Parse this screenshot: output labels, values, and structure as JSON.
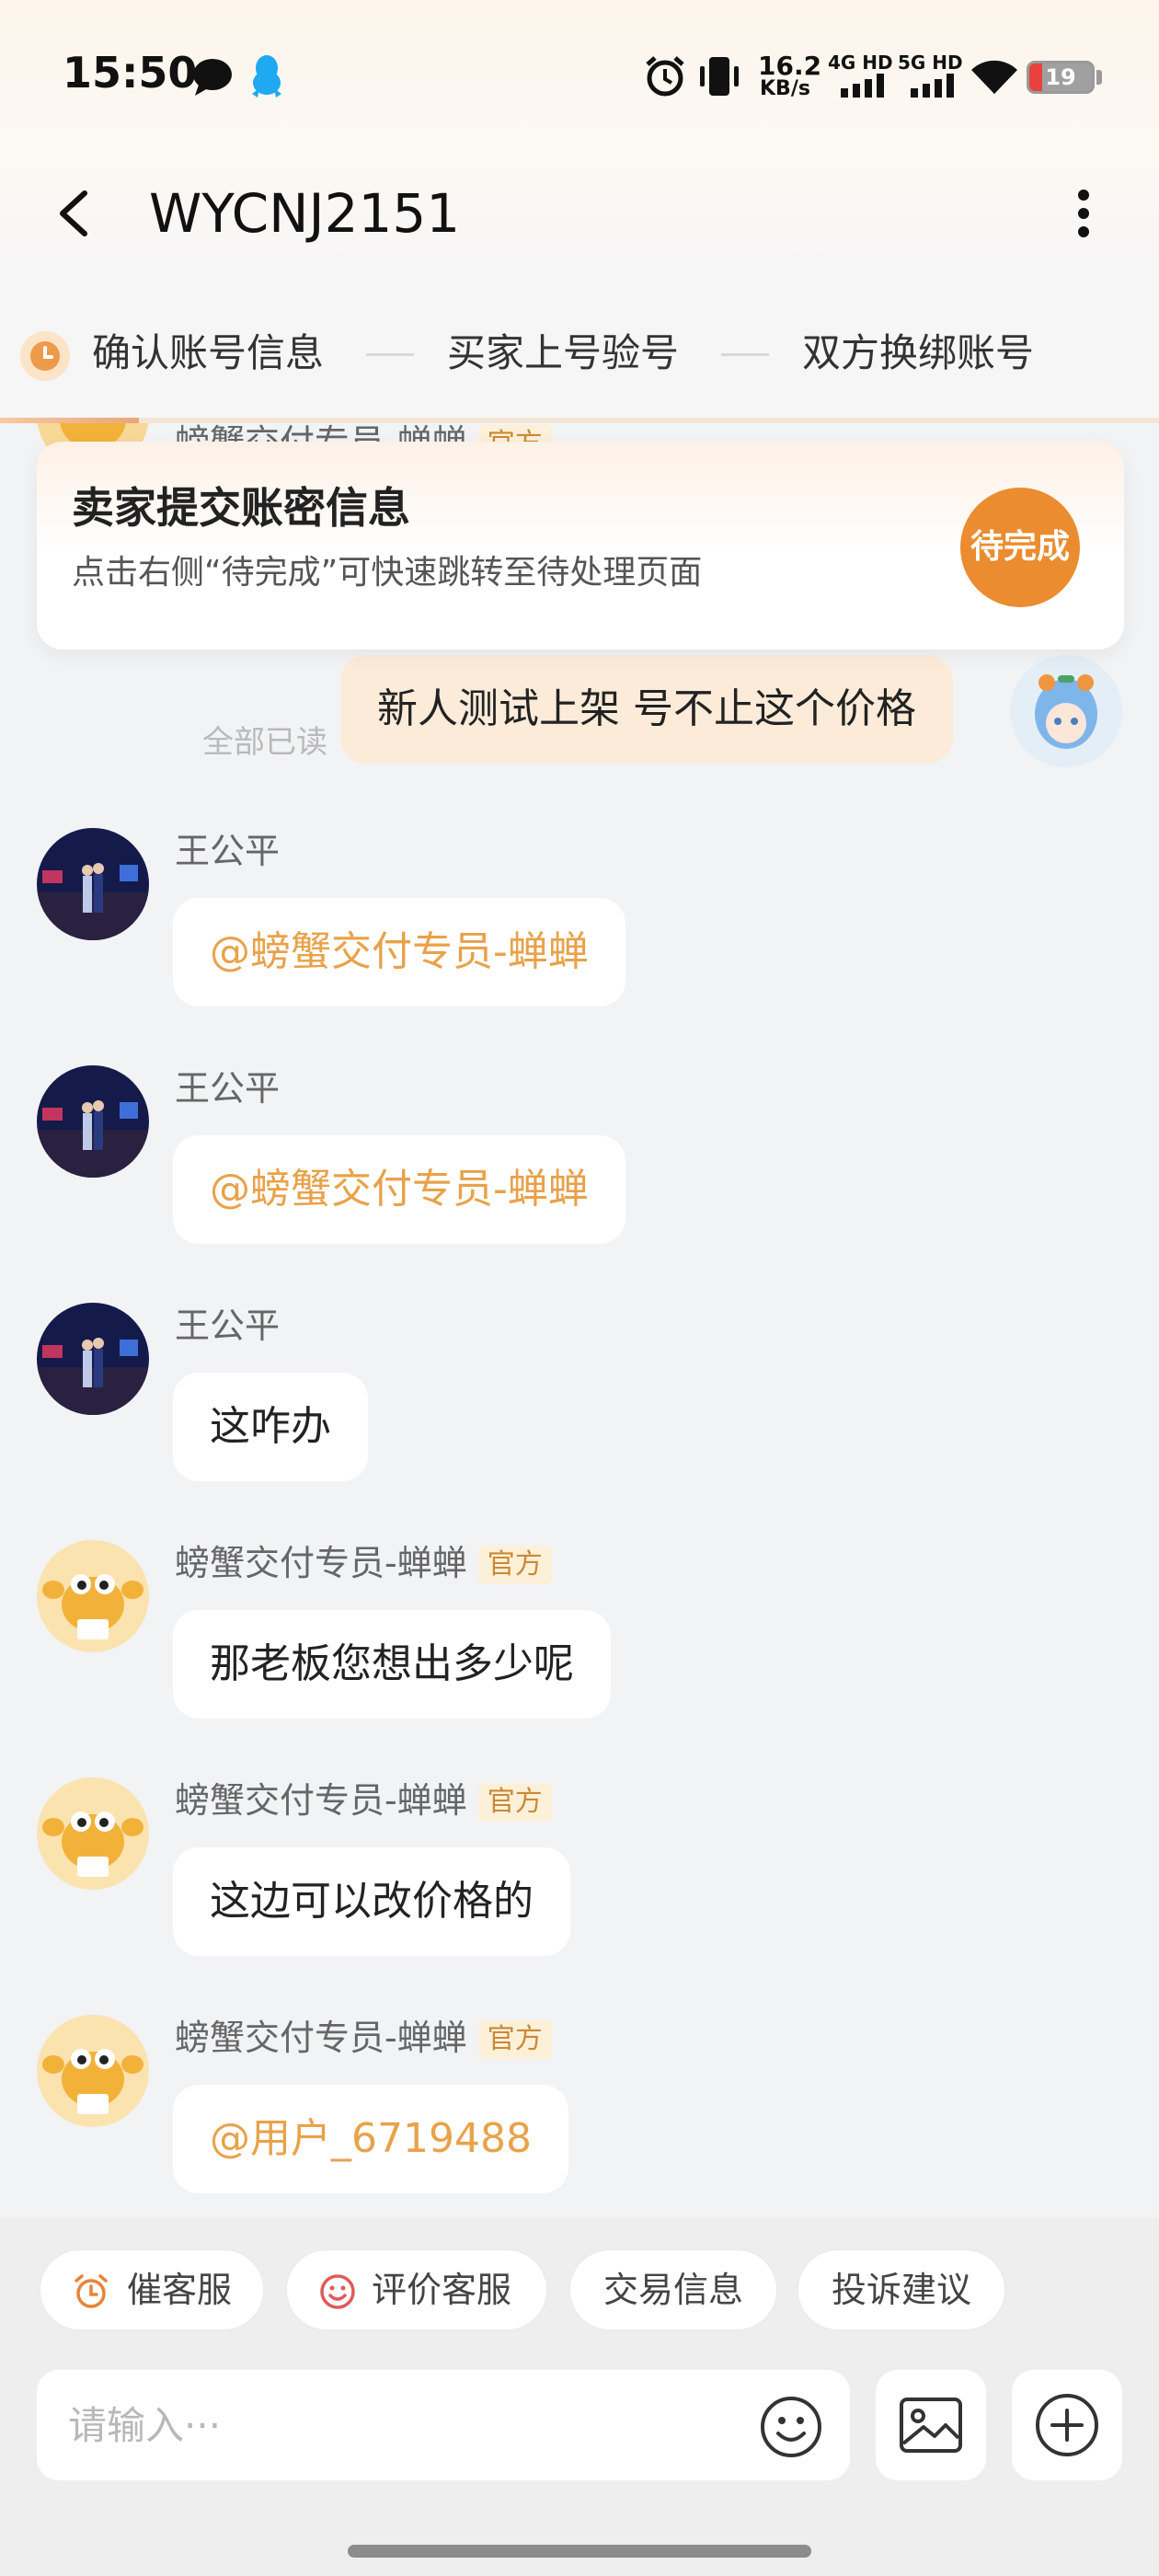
{
  "status_bar": {
    "time": "15:50",
    "net_speed_value": "16.2",
    "net_speed_unit": "KB/s",
    "net_4g": "4G HD",
    "net_5g": "5G HD",
    "battery": "19",
    "icons": [
      "chat-bubble-icon",
      "qq-penguin-icon",
      "alarm-icon",
      "vibrate-icon",
      "signal-4g-icon",
      "signal-5g-icon",
      "wifi-icon",
      "battery-icon"
    ]
  },
  "header": {
    "title": "WYCNJ2151"
  },
  "steps": {
    "items": [
      "确认账号信息",
      "买家上号验号",
      "双方换绑账号"
    ],
    "progress": 0.12
  },
  "banner": {
    "title": "卖家提交账密信息",
    "subtitle": "点击右侧“待完成”可快速跳转至待处理页面",
    "button": "待完成"
  },
  "chat": {
    "cutoff_sender": "螃蟹交付专员-蝉蝉",
    "official_badge": "官方",
    "own_message": {
      "text": "新人测试上架 号不止这个价格",
      "read_status": "全部已读"
    },
    "messages": [
      {
        "sender": "王公平",
        "text": "@螃蟹交付专员-蝉蝉"
      },
      {
        "sender": "王公平",
        "text": "@螃蟹交付专员-蝉蝉"
      },
      {
        "sender": "王公平",
        "text": "这咋办"
      },
      {
        "sender": "螃蟹交付专员-蝉蝉",
        "text": "那老板您想出多少呢"
      },
      {
        "sender": "螃蟹交付专员-蝉蝉",
        "text": "这边可以改价格的"
      },
      {
        "sender": "螃蟹交付专员-蝉蝉",
        "text": "@用户_6719488"
      }
    ]
  },
  "quick_actions": [
    "催客服",
    "评价客服",
    "交易信息",
    "投诉建议"
  ],
  "composer": {
    "placeholder": "请输入···"
  },
  "colors": {
    "accent": "#ea8c2f",
    "mention": "#e8a24a",
    "own_bubble": "#fcebd9",
    "background": "#f2f3f5"
  }
}
